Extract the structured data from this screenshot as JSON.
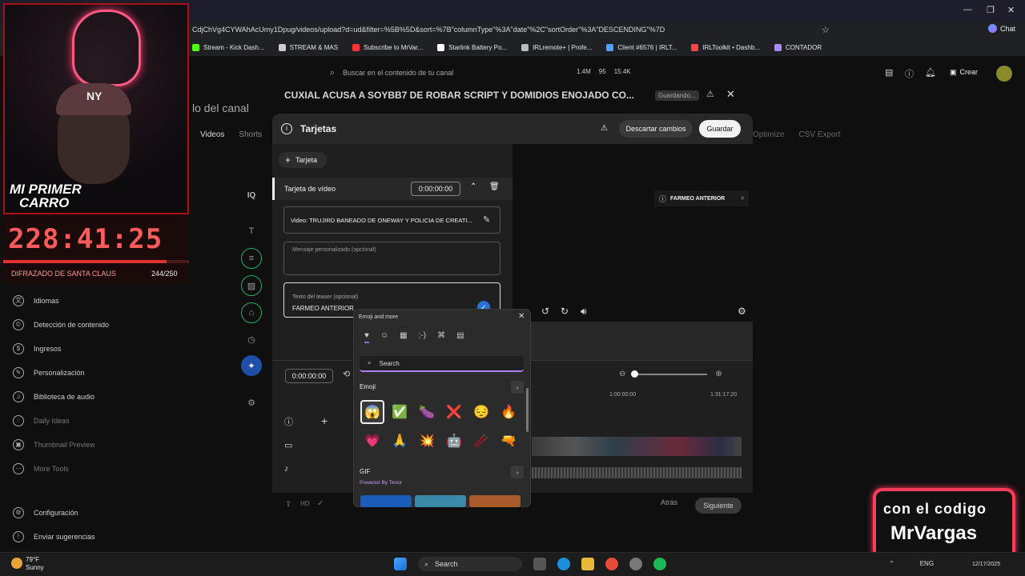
{
  "browser": {
    "url": "CdjChVg4CYWAhAcUmy1Dpug/videos/upload?d=ud&filter=%5B%5D&sort=%7B\"columnType\"%3A\"date\"%2C\"sortOrder\"%3A\"DESCENDING\"%7D",
    "chat_label": "Chat",
    "bookmarks": [
      {
        "label": "Stream - Kick Dash...",
        "color": "#53fc18"
      },
      {
        "label": "STREAM & MAS",
        "color": "#cccccc"
      },
      {
        "label": "Subscribe to MrVar...",
        "color": "#ff3333"
      },
      {
        "label": "Starlink Battery Po...",
        "color": "#ffffff"
      },
      {
        "label": "IRLremote+ | Profe...",
        "color": "#bbbbbb"
      },
      {
        "label": "Client #6576 | IRLT...",
        "color": "#4aa3ff"
      },
      {
        "label": "IRLToolkit • Dashb...",
        "color": "#ff4444"
      },
      {
        "label": "CONTADOR",
        "color": "#aa88ff"
      }
    ]
  },
  "header": {
    "search_placeholder": "Buscar en el contenido de tu canal",
    "stats": [
      "1.4M",
      "95",
      "15.4K"
    ],
    "create_label": "Crear"
  },
  "page": {
    "title": "lo del canal",
    "tabs": [
      "Videos",
      "Shorts"
    ],
    "right_tabs": [
      "Optimize",
      "CSV Export"
    ]
  },
  "nav": [
    {
      "label": "Idiomas",
      "icon": "language-icon",
      "dim": false
    },
    {
      "label": "Detección de contenido",
      "icon": "copyright-icon",
      "dim": false
    },
    {
      "label": "Ingresos",
      "icon": "dollar-icon",
      "dim": false
    },
    {
      "label": "Personalización",
      "icon": "brush-icon",
      "dim": false
    },
    {
      "label": "Biblioteca de audio",
      "icon": "audio-library-icon",
      "dim": false
    },
    {
      "label": "Daily Ideas",
      "icon": "ideas-icon",
      "dim": true
    },
    {
      "label": "Thumbnail Preview",
      "icon": "thumbnail-icon",
      "dim": true
    },
    {
      "label": "More Tools",
      "icon": "tools-icon",
      "dim": true
    },
    {
      "label": "Configuración",
      "icon": "gear-icon",
      "dim": false
    },
    {
      "label": "Enviar sugerencias",
      "icon": "feedback-icon",
      "dim": false
    }
  ],
  "video": {
    "title": "CUXIAL ACUSA A SOYBB7 DE ROBAR SCRIPT Y DOMIDIOS ENOJADO CO...",
    "saving_label": "Guardando..."
  },
  "dialog": {
    "title": "Tarjetas",
    "discard_label": "Descartar cambios",
    "save_label": "Guardar",
    "add_card_label": "Tarjeta",
    "card_type": "Tarjeta de vídeo",
    "card_time": "0:00:00:00",
    "video_field": "Video: TRUJIRD BANEADO DE ONEWAY Y POLICIA DE CREATI...",
    "message_placeholder": "Mensaje personalizado (opcional)",
    "teaser_label": "Texto del teaser (opcional)",
    "teaser_value": "FARMEO ANTERIOR",
    "preview_chip": "FARMEO ANTERIOR",
    "timeline_time": "0:00:00:00",
    "tick_1": "1:00:00:00",
    "tick_2": "1:31:17:20",
    "back_label": "Atrás",
    "next_label": "Siguiente"
  },
  "emoji_panel": {
    "title": "Emoji and more",
    "search_placeholder": "Search",
    "emoji_section": "Emoji",
    "gif_section": "GIF",
    "powered_by": "Powered By Tenor",
    "emojis": [
      "😱",
      "✅",
      "🍆",
      "❌",
      "😔",
      "🔥",
      "💗",
      "🙏",
      "💥",
      "🤖",
      "🥢",
      "🔫"
    ]
  },
  "overlay": {
    "car_text_1": "MI PRIMER",
    "car_text_2": "CARRO",
    "timer": "228:41:25",
    "timer_progress": 0.88,
    "sub_goal_label": "DIFRAZADO DE SANTA CLAUS",
    "sub_goal_count": "244/250",
    "cap_logo": "NY",
    "brand_top": "con el codigo",
    "brand_main": "MrVargas"
  },
  "taskbar": {
    "temperature": "79°F",
    "condition": "Sunny",
    "search_label": "Search",
    "lang": "ENG",
    "date": "12/17/2025"
  }
}
